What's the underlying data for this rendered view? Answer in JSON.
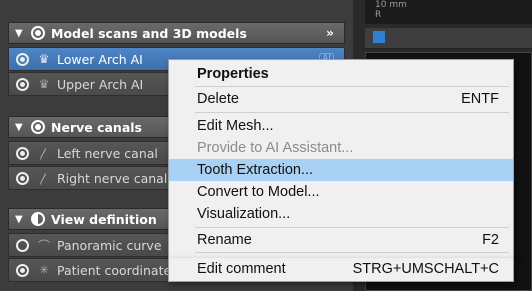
{
  "panel": {
    "groups": [
      {
        "title": "Model scans and 3D models",
        "items": [
          {
            "label": "Lower Arch AI",
            "badge": "AI",
            "selected": true
          },
          {
            "label": "Upper Arch AI"
          }
        ]
      },
      {
        "title": "Nerve canals",
        "items": [
          {
            "label": "Left nerve canal"
          },
          {
            "label": "Right nerve canal"
          }
        ]
      },
      {
        "title": "View definition",
        "items": [
          {
            "label": "Panoramic curve"
          },
          {
            "label": "Patient coordinate"
          }
        ]
      }
    ]
  },
  "viewer": {
    "top_label": "10 mm\nR",
    "unit_label": "nm"
  },
  "context_menu": {
    "items": [
      {
        "label": "Properties",
        "bold": true
      },
      {
        "label": "Delete",
        "shortcut": "ENTF"
      },
      {
        "label": "Edit Mesh..."
      },
      {
        "label": "Provide to AI Assistant...",
        "disabled": true
      },
      {
        "label": "Tooth Extraction...",
        "highlight": true
      },
      {
        "label": "Convert to Model..."
      },
      {
        "label": "Visualization..."
      },
      {
        "label": "Rename",
        "shortcut": "F2"
      },
      {
        "label": "Edit comment",
        "shortcut": "STRG+UMSCHALT+C"
      }
    ]
  },
  "colors": {
    "selection": "#4a7fc1",
    "menu_highlight": "#a9d1f3"
  }
}
